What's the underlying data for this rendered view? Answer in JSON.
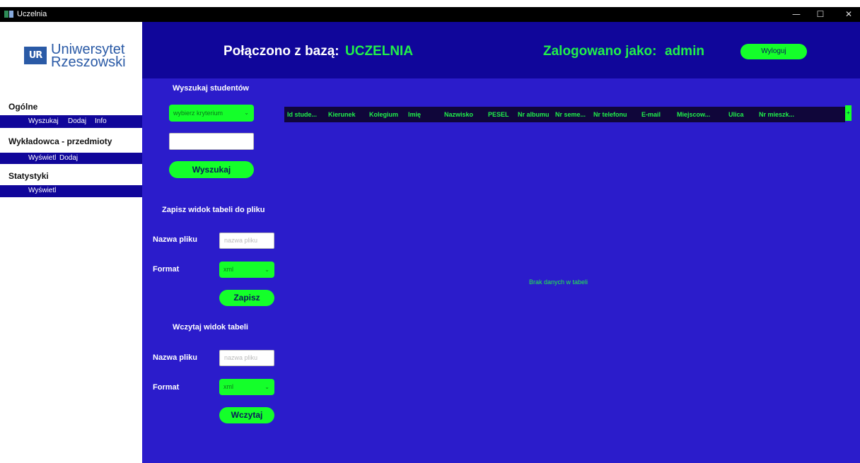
{
  "window": {
    "title": "Uczelnia",
    "controls": {
      "minimize": "—",
      "maximize": "☐",
      "close": "✕"
    }
  },
  "sidebar": {
    "logo": {
      "mark": "UR",
      "line1": "Uniwersytet",
      "line2": "Rzeszowski"
    },
    "sections": [
      {
        "heading": "Ogólne",
        "links": [
          "Wyszukaj",
          "Dodaj",
          "Info"
        ]
      },
      {
        "heading": "Wykładowca - przedmioty",
        "links": [
          "Wyświetl",
          "Dodaj"
        ]
      },
      {
        "heading": "Statystyki",
        "links": [
          "Wyświetl"
        ]
      }
    ]
  },
  "header": {
    "connected_label": "Połączono z bazą:",
    "database": "UCZELNIA",
    "logged_label": "Zalogowano jako:",
    "user": "admin",
    "logout": "Wyloguj"
  },
  "search": {
    "title": "Wyszukaj studentów",
    "criteria_select": "wybierz kryterium",
    "query_value": "",
    "button": "Wyszukaj"
  },
  "save": {
    "title": "Zapisz widok tabeli do pliku",
    "filename_label": "Nazwa pliku",
    "filename_placeholder": "nazwa pliku",
    "format_label": "Format",
    "format_value": "xml",
    "button": "Zapisz"
  },
  "load": {
    "title": "Wczytaj widok tabeli",
    "filename_label": "Nazwa pliku",
    "filename_placeholder": "nazwa pliku",
    "format_label": "Format",
    "format_value": "xml",
    "button": "Wczytaj"
  },
  "table": {
    "columns": [
      "Id stude...",
      "Kierunek",
      "Kolegium",
      "Imię",
      "Nazwisko",
      "PESEL",
      "Nr albumu",
      "Nr seme...",
      "Nr telefonu",
      "E-mail",
      "Miejscow...",
      "Ulica",
      "Nr mieszk..."
    ],
    "plus": "+",
    "empty_message": "Brak danych w tabeli"
  },
  "colors": {
    "header_bg": "#10069a",
    "content_bg": "#2b1ccb",
    "accent_green": "#14ff2a"
  }
}
